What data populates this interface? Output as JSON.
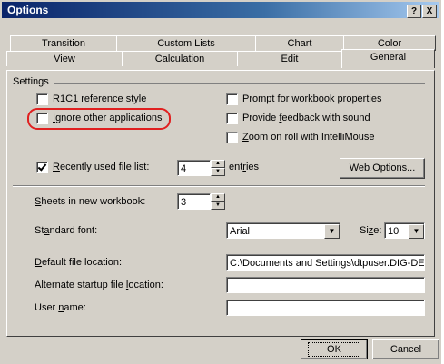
{
  "window": {
    "title": "Options"
  },
  "title_buttons": {
    "help": "?",
    "close": "X"
  },
  "tabs": {
    "row1": [
      "Transition",
      "Custom Lists",
      "Chart",
      "Color"
    ],
    "row2": [
      "View",
      "Calculation",
      "Edit",
      "General"
    ]
  },
  "settings": {
    "group_label": "Settings",
    "r1c1_pre": "R1",
    "r1c1_ul": "C",
    "r1c1_post": "1 reference style",
    "ignore_pre": "",
    "ignore_ul": "I",
    "ignore_post": "gnore other applications",
    "prompt_pre": "",
    "prompt_ul": "P",
    "prompt_post": "rompt for workbook properties",
    "feedback_pre": "Provide ",
    "feedback_ul": "f",
    "feedback_post": "eedback with sound",
    "zoom_pre": "",
    "zoom_ul": "Z",
    "zoom_post": "oom on roll with IntelliMouse",
    "recent_pre": "",
    "recent_ul": "R",
    "recent_post": "ecently used file list:",
    "recent_value": "4",
    "entries_pre": "ent",
    "entries_ul": "r",
    "entries_post": "ies",
    "web_pre": "",
    "web_ul": "W",
    "web_post": "eb Options..."
  },
  "sheets": {
    "pre": "",
    "ul": "S",
    "post": "heets in new workbook:",
    "value": "3"
  },
  "font": {
    "label_pre": "St",
    "label_ul": "a",
    "label_post": "ndard font:",
    "value": "Arial",
    "size_pre": "Si",
    "size_ul": "z",
    "size_post": "e:",
    "size_value": "10"
  },
  "default_location": {
    "pre": "",
    "ul": "D",
    "post": "efault file location:",
    "value": "C:\\Documents and Settings\\dtpuser.DIG-DE\\"
  },
  "alternate_location": {
    "pre": "Alternate startup file ",
    "ul": "l",
    "post": "ocation:",
    "value": ""
  },
  "user_name": {
    "pre": "User ",
    "ul": "n",
    "post": "ame:",
    "value": ""
  },
  "buttons": {
    "ok": "OK",
    "cancel": "Cancel"
  },
  "colors": {
    "highlight_ring": "#e02020",
    "title_bar": "#0a246a",
    "face": "#d4d0c8"
  }
}
